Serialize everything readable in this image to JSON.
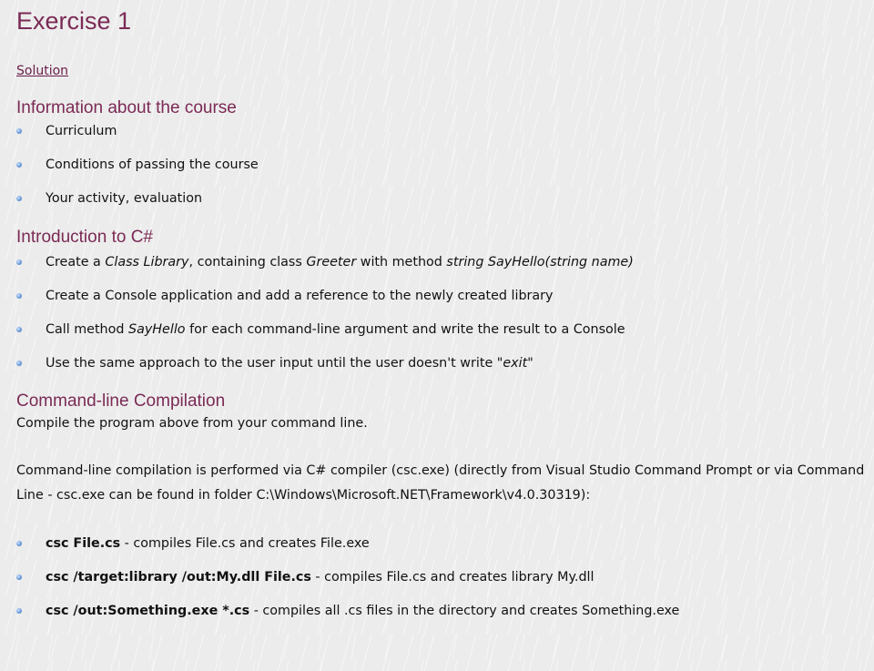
{
  "title": "Exercise 1",
  "solution_link": "Solution",
  "sections": {
    "info": {
      "heading": "Information about the course",
      "items": [
        "Curriculum",
        "Conditions of passing the course",
        "Your activity, evaluation"
      ]
    },
    "intro": {
      "heading": "Introduction to C#",
      "item1": {
        "t1": "Create a ",
        "i1": "Class Library",
        "t2": ", containing class ",
        "i2": "Greeter",
        "t3": " with method ",
        "i3": "string SayHello(string name)"
      },
      "item2": "Create a Console application and add a reference to the newly created library",
      "item3": {
        "t1": "Call method ",
        "i1": "SayHello",
        "t2": " for each command-line argument and write the result to a Console"
      },
      "item4": {
        "t1": "Use the same approach to the user input until the user doesn't write \"",
        "i1": "exit",
        "t2": "\""
      }
    },
    "cli": {
      "heading": "Command-line Compilation",
      "para1": "Compile the program above from your command line.",
      "para2": "Command-line compilation is performed via C# compiler (csc.exe) (directly from Visual Studio Command Prompt or via Command Line - csc.exe can be found in folder C:\\Windows\\Microsoft.NET\\Framework\\v4.0.30319):",
      "items": [
        {
          "cmd": "csc File.cs",
          "desc": " - compiles File.cs and creates File.exe"
        },
        {
          "cmd": "csc /target:library /out:My.dll File.cs",
          "desc": " - compiles File.cs and creates library My.dll"
        },
        {
          "cmd": "csc /out:Something.exe *.cs",
          "desc": " - compiles all .cs files in the directory and creates Something.exe"
        }
      ]
    }
  },
  "colors": {
    "heading": "#7b2a55",
    "link": "#6a1d48",
    "bullet": "#6b9ad8",
    "background": "#ececec"
  }
}
